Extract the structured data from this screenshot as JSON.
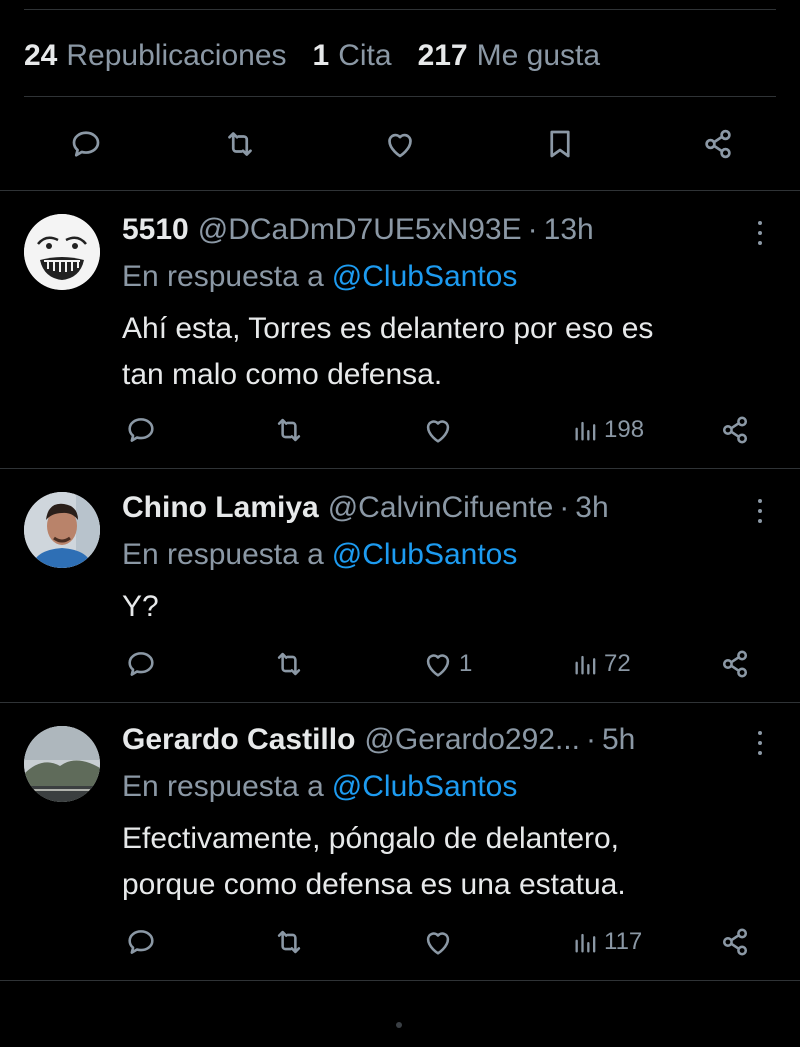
{
  "stats": {
    "reposts_count": "24",
    "reposts_label": "Republicaciones",
    "quotes_count": "1",
    "quotes_label": "Cita",
    "likes_count": "217",
    "likes_label": "Me gusta"
  },
  "action_bar": {
    "icons": [
      "reply-icon",
      "repost-icon",
      "like-icon",
      "bookmark-icon",
      "share-icon"
    ]
  },
  "replies": [
    {
      "name": "5510",
      "handle": "@DCaDmD7UE5xN93E",
      "dot": "·",
      "time": "13h",
      "reply_prefix": "En respuesta a",
      "reply_to": "@ClubSantos",
      "text_lines": [
        "Ahí esta, Torres es delantero por eso es",
        "tan malo como defensa."
      ],
      "likes": "",
      "views": "198"
    },
    {
      "name": "Chino Lamiya",
      "handle": "@CalvinCifuente",
      "dot": "·",
      "time": "3h",
      "reply_prefix": "En respuesta a",
      "reply_to": "@ClubSantos",
      "text_lines": [
        "Y?"
      ],
      "likes": "1",
      "views": "72"
    },
    {
      "name": "Gerardo Castillo",
      "handle": "@Gerardo292...",
      "dot": "·",
      "time": "5h",
      "reply_prefix": "En respuesta a",
      "reply_to": "@ClubSantos",
      "text_lines": [
        "Efectivamente, póngalo de delantero,",
        "porque como defensa es una estatua."
      ],
      "likes": "",
      "views": "117"
    }
  ],
  "colors": {
    "background": "#000000",
    "text": "#e7e9ea",
    "secondary": "#8b98a5",
    "accent": "#1d9bf0",
    "divider": "#2f3336"
  }
}
